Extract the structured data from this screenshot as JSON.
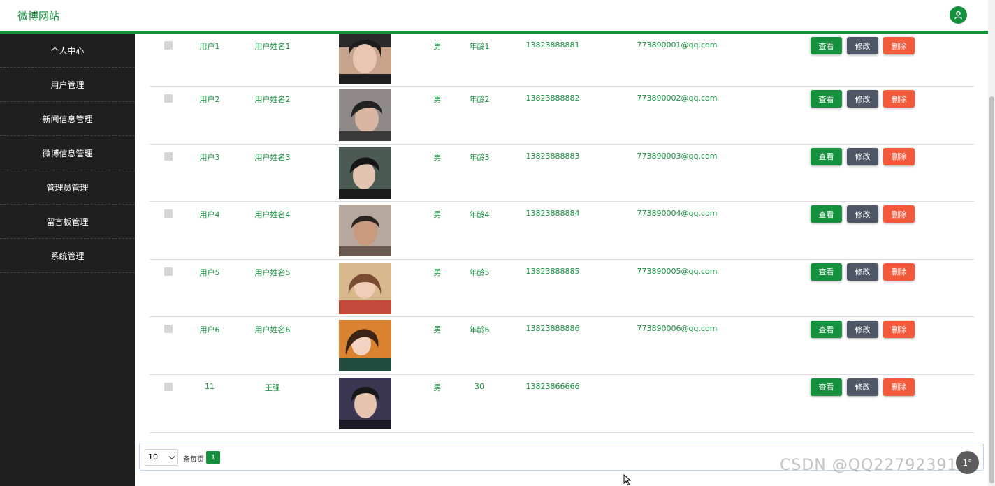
{
  "app": {
    "title": "微博网站"
  },
  "header": {
    "user_icon": "user-icon"
  },
  "sidebar": {
    "items": [
      {
        "label": "个人中心"
      },
      {
        "label": "用户管理"
      },
      {
        "label": "新闻信息管理"
      },
      {
        "label": "微博信息管理"
      },
      {
        "label": "管理员管理"
      },
      {
        "label": "留言板管理"
      },
      {
        "label": "系统管理"
      }
    ]
  },
  "table": {
    "rows": [
      {
        "user": "用户1",
        "name": "用户姓名1",
        "sex": "男",
        "age": "年龄1",
        "phone": "13823888881",
        "email": "773890001@qq.com"
      },
      {
        "user": "用户2",
        "name": "用户姓名2",
        "sex": "男",
        "age": "年龄2",
        "phone": "13823888882",
        "email": "773890002@qq.com"
      },
      {
        "user": "用户3",
        "name": "用户姓名3",
        "sex": "男",
        "age": "年龄3",
        "phone": "13823888883",
        "email": "773890003@qq.com"
      },
      {
        "user": "用户4",
        "name": "用户姓名4",
        "sex": "男",
        "age": "年龄4",
        "phone": "13823888884",
        "email": "773890004@qq.com"
      },
      {
        "user": "用户5",
        "name": "用户姓名5",
        "sex": "男",
        "age": "年龄5",
        "phone": "13823888885",
        "email": "773890005@qq.com"
      },
      {
        "user": "用户6",
        "name": "用户姓名6",
        "sex": "男",
        "age": "年龄6",
        "phone": "13823888886",
        "email": "773890006@qq.com"
      },
      {
        "user": "11",
        "name": "王强",
        "sex": "男",
        "age": "30",
        "phone": "13823866666",
        "email": ""
      }
    ],
    "actions": {
      "view": "查看",
      "edit": "修改",
      "delete": "删除"
    }
  },
  "pager": {
    "page_size": "10",
    "label": "条每页",
    "current_page": "1"
  },
  "floating": {
    "back_top": "1°"
  },
  "watermark": "CSDN @QQ2279239102",
  "colors": {
    "primary": "#15913d",
    "edit": "#4f5766",
    "delete": "#f25a3b",
    "sidebar": "#1f1f1f"
  }
}
